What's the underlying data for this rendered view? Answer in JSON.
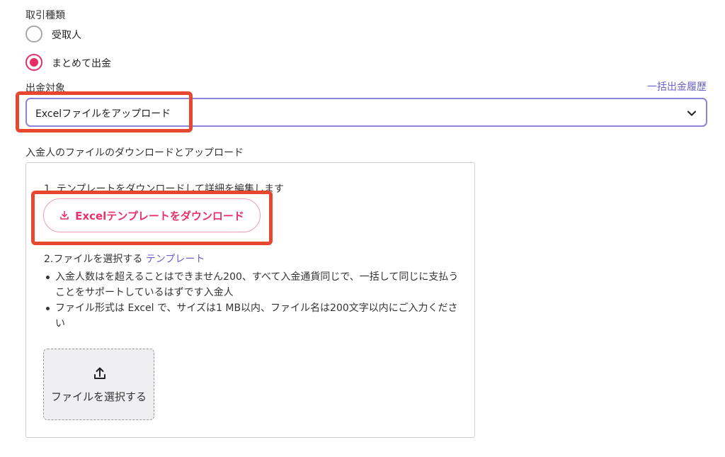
{
  "transaction_type": {
    "label": "取引種類",
    "options": [
      {
        "label": "受取人",
        "selected": false
      },
      {
        "label": "まとめて出金",
        "selected": true
      }
    ]
  },
  "payout_target": {
    "label": "出金対象",
    "history_link": "一括出金履歴",
    "selected_value": "Excelファイルをアップロード"
  },
  "upload_section": {
    "title": "入金人のファイルのダウンロードとアップロード",
    "step1_text": "1. テンプレートをダウンロードして詳細を編集します",
    "download_button_label": "Excelテンプレートをダウンロード",
    "step2_text": "2.ファイルを選択する",
    "step2_link": "テンプレート",
    "bullets": [
      "入金人数はを超えることはできません200、すべて入金通貨同じで、一括して同じに支払うことをサポートしているはずです入金人",
      "ファイル形式は Excel で、サイズは1 MB以内、ファイル名は200文字以内にご入力ください"
    ],
    "select_file_label": "ファイルを選択する"
  },
  "colors": {
    "accent_pink": "#ea2b65",
    "link_purple": "#6a63c4",
    "highlight_red": "#e8472f"
  }
}
